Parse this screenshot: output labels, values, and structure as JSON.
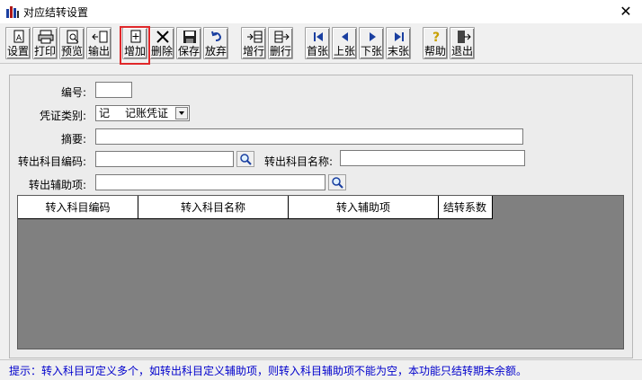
{
  "window": {
    "title": "对应结转设置",
    "close_glyph": "✕"
  },
  "toolbar": {
    "buttons": [
      {
        "label": "设置",
        "icon": "document-icon"
      },
      {
        "label": "打印",
        "icon": "printer-icon"
      },
      {
        "label": "预览",
        "icon": "preview-icon"
      },
      {
        "label": "输出",
        "icon": "export-icon"
      },
      {
        "label": "增加",
        "icon": "add-icon"
      },
      {
        "label": "删除",
        "icon": "delete-icon"
      },
      {
        "label": "保存",
        "icon": "save-icon"
      },
      {
        "label": "放弃",
        "icon": "undo-icon"
      },
      {
        "label": "增行",
        "icon": "insert-row-icon"
      },
      {
        "label": "删行",
        "icon": "delete-row-icon"
      },
      {
        "label": "首张",
        "icon": "first-icon"
      },
      {
        "label": "上张",
        "icon": "prev-icon"
      },
      {
        "label": "下张",
        "icon": "next-icon"
      },
      {
        "label": "末张",
        "icon": "last-icon"
      },
      {
        "label": "帮助",
        "icon": "help-icon"
      },
      {
        "label": "退出",
        "icon": "exit-icon"
      }
    ],
    "highlighted": "增加"
  },
  "form": {
    "number_label": "编号:",
    "number_value": "",
    "voucher_type_label": "凭证类别:",
    "voucher_type_code": "记",
    "voucher_type_name": "记账凭证",
    "summary_label": "摘要:",
    "summary_value": "",
    "out_account_code_label": "转出科目编码:",
    "out_account_code_value": "",
    "out_account_name_label": "转出科目名称:",
    "out_account_name_value": "",
    "out_aux_label": "转出辅助项:",
    "out_aux_value": ""
  },
  "grid": {
    "columns": [
      "转入科目编码",
      "转入科目名称",
      "转入辅助项",
      "结转系数"
    ],
    "rows": []
  },
  "status": {
    "hint": "提示：转入科目可定义多个，如转出科目定义辅助项，则转入科目辅助项不能为空，本功能只结转期末余额。"
  },
  "colors": {
    "hint_text": "#0000cc",
    "grid_background": "#808080",
    "highlight_border": "#e0282a"
  }
}
